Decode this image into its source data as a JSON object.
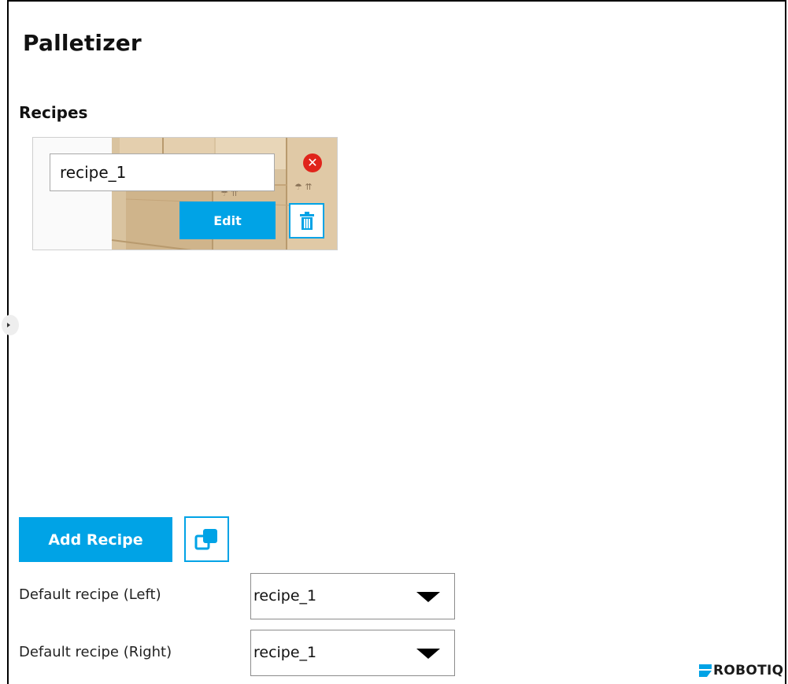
{
  "page": {
    "title": "Palletizer"
  },
  "recipes": {
    "section_label": "Recipes",
    "items": [
      {
        "name": "recipe_1",
        "edit_label": "Edit"
      }
    ]
  },
  "actions": {
    "add_recipe_label": "Add Recipe"
  },
  "defaults": {
    "left_label": "Default recipe (Left)",
    "left_value": "recipe_1",
    "right_label": "Default recipe (Right)",
    "right_value": "recipe_1"
  },
  "brand": {
    "logo_text": "ROBOTIQ"
  },
  "colors": {
    "accent": "#00a3e6",
    "danger": "#e0241b",
    "cardboard": "#dcc5a3"
  },
  "icons": {
    "close": "close-circle-icon",
    "trash": "trash-icon",
    "copy": "copy-icon",
    "dropdown": "chevron-down-icon",
    "logo": "robotiq-logo-icon"
  }
}
